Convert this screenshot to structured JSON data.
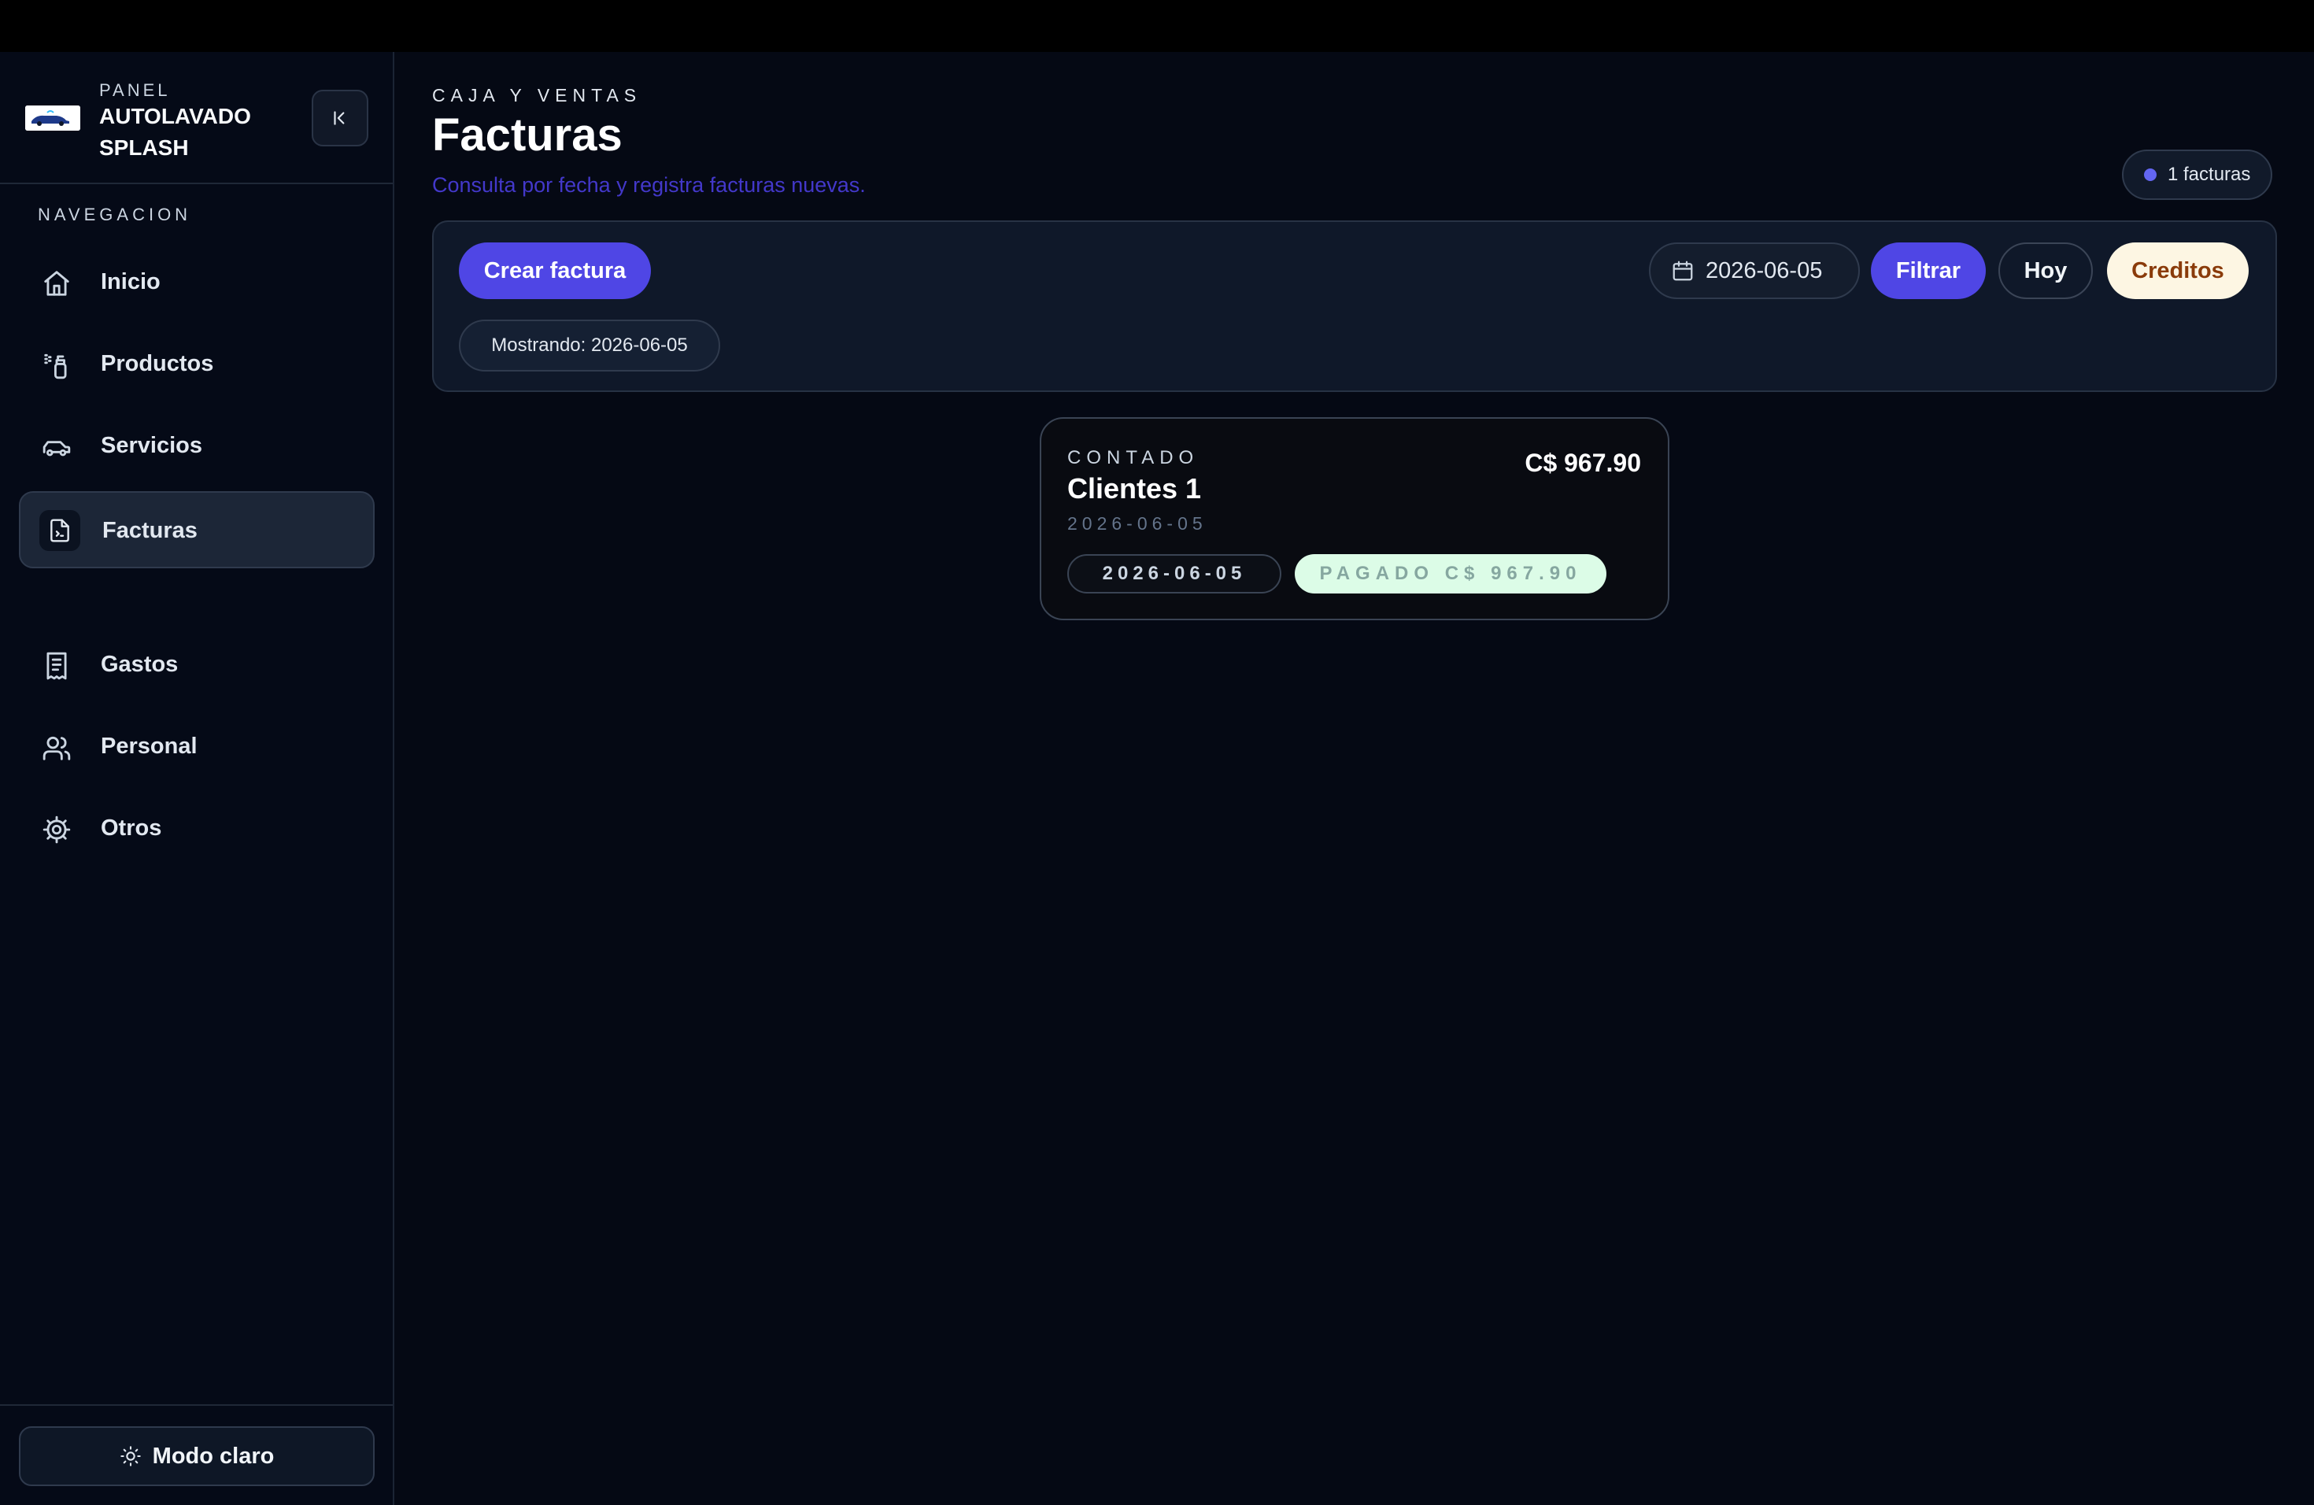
{
  "sidebar": {
    "brand_kicker": "PANEL",
    "brand_name_line1": "AUTOLAVADO",
    "brand_name_line2": "SPLASH",
    "nav_heading": "NAVEGACION",
    "items": [
      {
        "label": "Inicio",
        "icon": "home-icon",
        "active": false
      },
      {
        "label": "Productos",
        "icon": "spray-bottle-icon",
        "active": false
      },
      {
        "label": "Servicios",
        "icon": "car-icon",
        "active": false
      },
      {
        "label": "Facturas",
        "icon": "invoice-file-icon",
        "active": true
      },
      {
        "label": "Gastos",
        "icon": "receipt-icon",
        "active": false
      },
      {
        "label": "Personal",
        "icon": "users-icon",
        "active": false
      },
      {
        "label": "Otros",
        "icon": "gear-icon",
        "active": false
      }
    ],
    "theme_toggle_label": "Modo claro"
  },
  "header": {
    "kicker": "CAJA Y VENTAS",
    "title": "Facturas",
    "subtitle": "Consulta por fecha y registra facturas nuevas.",
    "count_badge": "1 facturas"
  },
  "toolbar": {
    "create_label": "Crear factura",
    "date_value": "2026-06-05",
    "filter_label": "Filtrar",
    "today_label": "Hoy",
    "credits_label": "Creditos",
    "showing_label": "Mostrando: 2026-06-05"
  },
  "invoices": [
    {
      "type": "CONTADO",
      "client": "Clientes 1",
      "date": "2026-06-05",
      "amount": "C$ 967.90",
      "date_chip": "2026-06-05",
      "status_chip": "PAGADO C$ 967.90"
    }
  ],
  "colors": {
    "accent": "#4f46e5",
    "background": "#050914",
    "paid_badge": "#dcfce7",
    "credits_button": "#fdf6e3"
  }
}
